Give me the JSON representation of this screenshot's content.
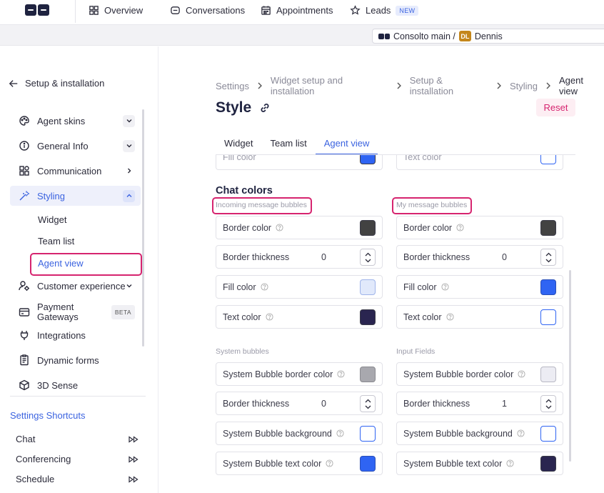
{
  "nav": {
    "items": [
      {
        "label": "Overview",
        "icon": "grid-icon"
      },
      {
        "label": "Conversations",
        "icon": "chat-icon"
      },
      {
        "label": "Appointments",
        "icon": "calendar-icon"
      },
      {
        "label": "Leads",
        "icon": "star-icon"
      }
    ],
    "new_badge": "NEW"
  },
  "account": {
    "workspace": "Consolto main /",
    "initials": "DL",
    "user": "Dennis"
  },
  "sidebar": {
    "back_label": "Setup & installation",
    "items": [
      {
        "label": "Agent skins"
      },
      {
        "label": "General Info"
      },
      {
        "label": "Communication"
      },
      {
        "label": "Styling"
      },
      {
        "label": "Customer experience"
      },
      {
        "label": "Payment\nGateways",
        "badge": "BETA"
      },
      {
        "label": "Integrations"
      },
      {
        "label": "Dynamic forms"
      },
      {
        "label": "3D Sense"
      }
    ],
    "styling_sub": [
      "Widget",
      "Team list",
      "Agent view"
    ],
    "shortcuts_title": "Settings Shortcuts",
    "shortcuts": [
      "Chat",
      "Conferencing",
      "Schedule"
    ]
  },
  "breadcrumb": [
    "Settings",
    "Widget setup and installation",
    "Setup & installation",
    "Styling",
    "Agent view"
  ],
  "page": {
    "title": "Style",
    "reset_label": "Reset"
  },
  "tabs": [
    "Widget",
    "Team list",
    "Agent view"
  ],
  "top_cut": {
    "left": "Fill color",
    "right": "Text color"
  },
  "chat_colors": {
    "title": "Chat colors",
    "incoming": {
      "label": "Incoming message bubbles",
      "border_color": "Border color",
      "border_thickness": "Border thickness",
      "thickness_value": "0",
      "fill_color": "Fill color",
      "text_color": "Text color"
    },
    "mine": {
      "label": "My message bubbles",
      "border_color": "Border color",
      "border_thickness": "Border thickness",
      "thickness_value": "0",
      "fill_color": "Fill color",
      "text_color": "Text color"
    }
  },
  "system": {
    "label": "System bubbles",
    "border_color": "System Bubble border color",
    "border_thickness": "Border thickness",
    "thickness_value": "0",
    "background": "System Bubble background",
    "text_color": "System Bubble text color"
  },
  "input_fields": {
    "label": "Input Fields",
    "border_color": "System Bubble border color",
    "border_thickness": "Border thickness",
    "thickness_value": "1",
    "background": "System Bubble background",
    "text_color": "System Bubble text color"
  },
  "colors": {
    "accent": "#3b63e0",
    "highlight": "#d6246f",
    "swatch_dark": "#424242",
    "swatch_light_blue": "#e1e9fb",
    "swatch_navy": "#2a2550",
    "swatch_blue": "#2f64f3",
    "swatch_white": "#ffffff",
    "swatch_gray": "#a8a8ae",
    "swatch_pale": "#ececf3"
  }
}
